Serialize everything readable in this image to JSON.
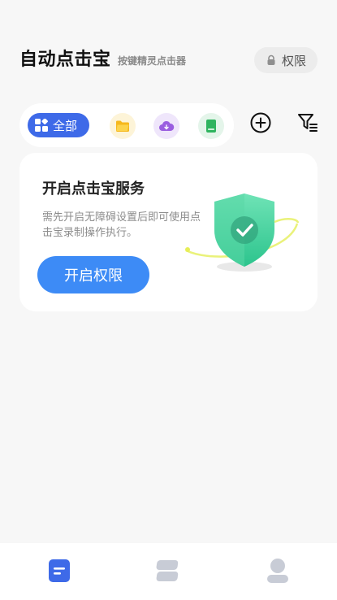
{
  "header": {
    "title": "自动点击宝",
    "subtitle": "按键精灵点击器",
    "permission_label": "权限"
  },
  "filters": {
    "all_label": "全部",
    "items": [
      "folder-icon",
      "cloud-icon",
      "book-icon"
    ]
  },
  "colors": {
    "accent": "#3e6ae8",
    "button": "#3d8bf6",
    "folder": "#f6c324",
    "cloud": "#9a5ee0",
    "book": "#2fb45f",
    "shield": "#4fd6a6"
  },
  "service_card": {
    "title": "开启点击宝服务",
    "description": "需先开启无障碍设置后即可使用点击宝录制操作执行。",
    "button_label": "开启权限"
  },
  "bottom_nav": [
    "home-icon",
    "records-icon",
    "profile-icon"
  ]
}
